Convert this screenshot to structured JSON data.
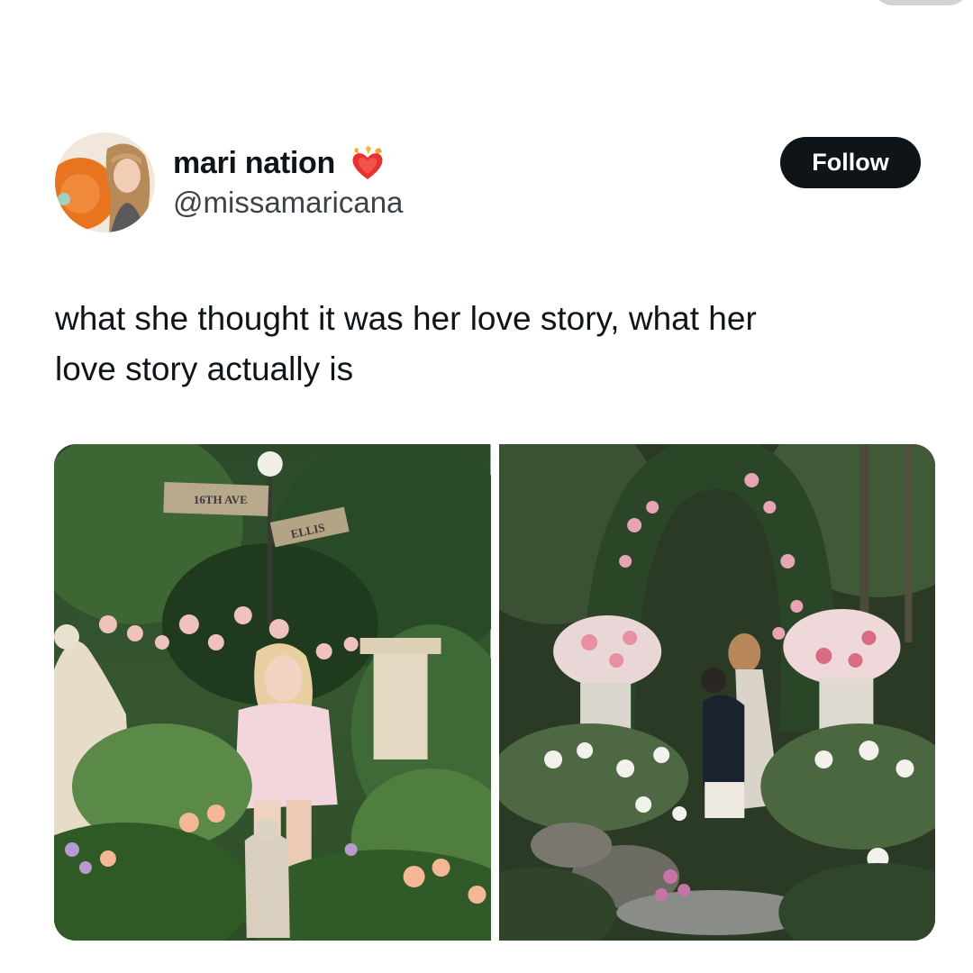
{
  "user": {
    "display_name": "mari nation",
    "badge_icon": "flaming-heart-icon",
    "handle": "@missamaricana"
  },
  "actions": {
    "follow_label": "Follow"
  },
  "tweet": {
    "text_line1": "what she thought it was her love story, what her",
    "text_line2": "love story actually is"
  },
  "media": {
    "photos": [
      {
        "sign_1": "16TH AVE",
        "sign_2": "ELLIS"
      },
      {}
    ]
  },
  "colors": {
    "follow_bg": "#0f1419",
    "text": "#0f1419",
    "handle": "#3c4248"
  }
}
